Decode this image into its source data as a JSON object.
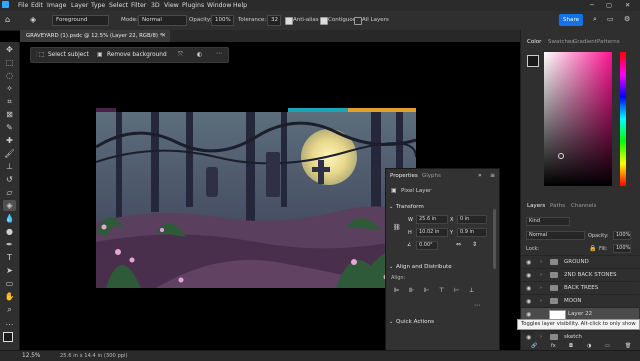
{
  "menu": {
    "items": [
      "File",
      "Edit",
      "Image",
      "Layer",
      "Type",
      "Select",
      "Filter",
      "3D",
      "View",
      "Plugins",
      "Window",
      "Help"
    ]
  },
  "options": {
    "sample": "Foreground",
    "mode_label": "Mode:",
    "mode_value": "Normal",
    "opacity_label": "Opacity:",
    "opacity_value": "100%",
    "tolerance_label": "Tolerance:",
    "tolerance_value": "32",
    "antialias": "Anti-alias",
    "contiguous": "Contiguous",
    "all_layers": "All Layers",
    "share": "Share"
  },
  "doc_tab": {
    "title": "GRAVEYARD (1).psdc @ 12.5% (Layer 22, RGB/8) *"
  },
  "context_bar": {
    "select_subject": "Select subject",
    "remove_background": "Remove background"
  },
  "panel_tabs_top": [
    "Color",
    "Swatches",
    "Gradient",
    "Patterns"
  ],
  "layers_tabs": [
    "Layers",
    "Paths",
    "Channels"
  ],
  "layers_panel": {
    "kind": "Kind",
    "blend": "Normal",
    "opacity_label": "Opacity:",
    "opacity_value": "100%",
    "lock_label": "Lock:",
    "fill_label": "Fill:",
    "fill_value": "100%",
    "layers": [
      {
        "name": "GROUND"
      },
      {
        "name": "2ND BACK STONES"
      },
      {
        "name": "BACK TREES"
      },
      {
        "name": "MOON"
      },
      {
        "name": "Layer 22"
      },
      {
        "name": "sketch"
      }
    ]
  },
  "tooltip": "Toggles layer visibility. Alt-click to only show layer.",
  "properties": {
    "tabs": [
      "Properties",
      "Glyphs"
    ],
    "pixel_layer": "Pixel Layer",
    "transform": "Transform",
    "w_label": "W",
    "w_value": "25.6 in",
    "h_label": "H",
    "h_value": "10.02 in",
    "x_label": "X",
    "x_value": "0 in",
    "y_label": "Y",
    "y_value": "0.9 in",
    "angle_value": "0.00°",
    "align": "Align and Distribute",
    "align_sub": "Align:",
    "quick_actions": "Quick Actions"
  },
  "status": {
    "zoom": "12.5%",
    "dims": "25.6 in x 14.4 in (300 ppi)"
  },
  "colors": {
    "accent": "#1473e6",
    "bar_teal": "#1aa7b3",
    "bar_orange": "#e0a22a",
    "bar_purple": "#4a2148"
  },
  "icons": [
    "home-icon",
    "bucket-icon",
    "chevron-down-icon",
    "search-icon",
    "gear-icon",
    "eye-icon",
    "folder-icon",
    "lock-icon",
    "link-icon"
  ]
}
